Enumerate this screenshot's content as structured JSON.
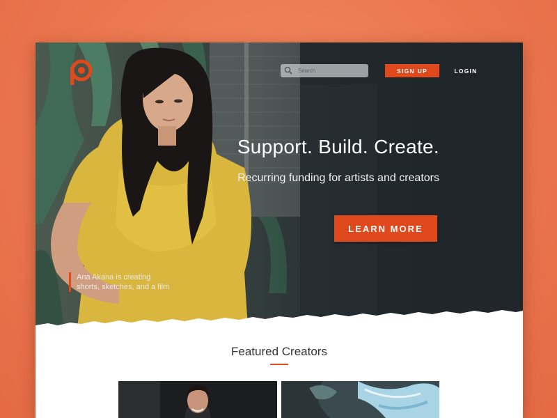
{
  "nav": {
    "search_placeholder": "Search",
    "signup_label": "SIGN UP",
    "login_label": "LOGIN"
  },
  "hero": {
    "headline": "Support. Build. Create.",
    "subheadline": "Recurring funding for artists and creators",
    "cta_label": "LEARN MORE",
    "caption_line1": "Ana Akana is creating",
    "caption_line2": "shorts, sketches, and a film"
  },
  "featured": {
    "title": "Featured Creators"
  },
  "icons": {
    "logo": "patreon-logo-icon",
    "search": "search-icon"
  },
  "colors": {
    "accent": "#e0491e",
    "background": "#ec7a52",
    "hero_dark": "#23292c"
  }
}
